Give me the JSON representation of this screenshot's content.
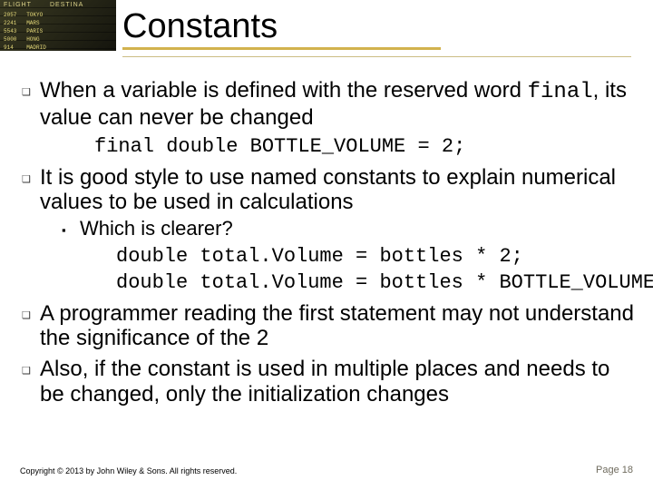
{
  "decor": {
    "board_col1": "FLIGHT",
    "board_col2": "DESTINA",
    "board_rows": "2057   TOKYO\n2241   MARS\n5543   PARIS\n5000   HONG\n914    MADRID"
  },
  "title": "Constants",
  "bullets": {
    "p1_a": "When a variable is defined with the reserved word ",
    "p1_code": "final",
    "p1_b": ", its value can never be changed",
    "code1": "final double BOTTLE_VOLUME = 2;",
    "p2": "It is good style to use named constants to explain numerical values to be used in calculations",
    "p2_sub": "Which is clearer?",
    "codeA": "double total.Volume = bottles * 2;",
    "codeB": "double total.Volume = bottles * BOTTLE_VOLUME;",
    "p3": "A programmer reading the first statement may not understand the significance of the 2",
    "p4": "Also, if the constant is used in multiple places and needs to be changed, only the initialization changes"
  },
  "footer": {
    "copyright": "Copyright © 2013 by John Wiley & Sons. All rights reserved.",
    "page": "Page 18"
  },
  "marks": {
    "square_hollow": "❑",
    "square_solid": "▪"
  }
}
